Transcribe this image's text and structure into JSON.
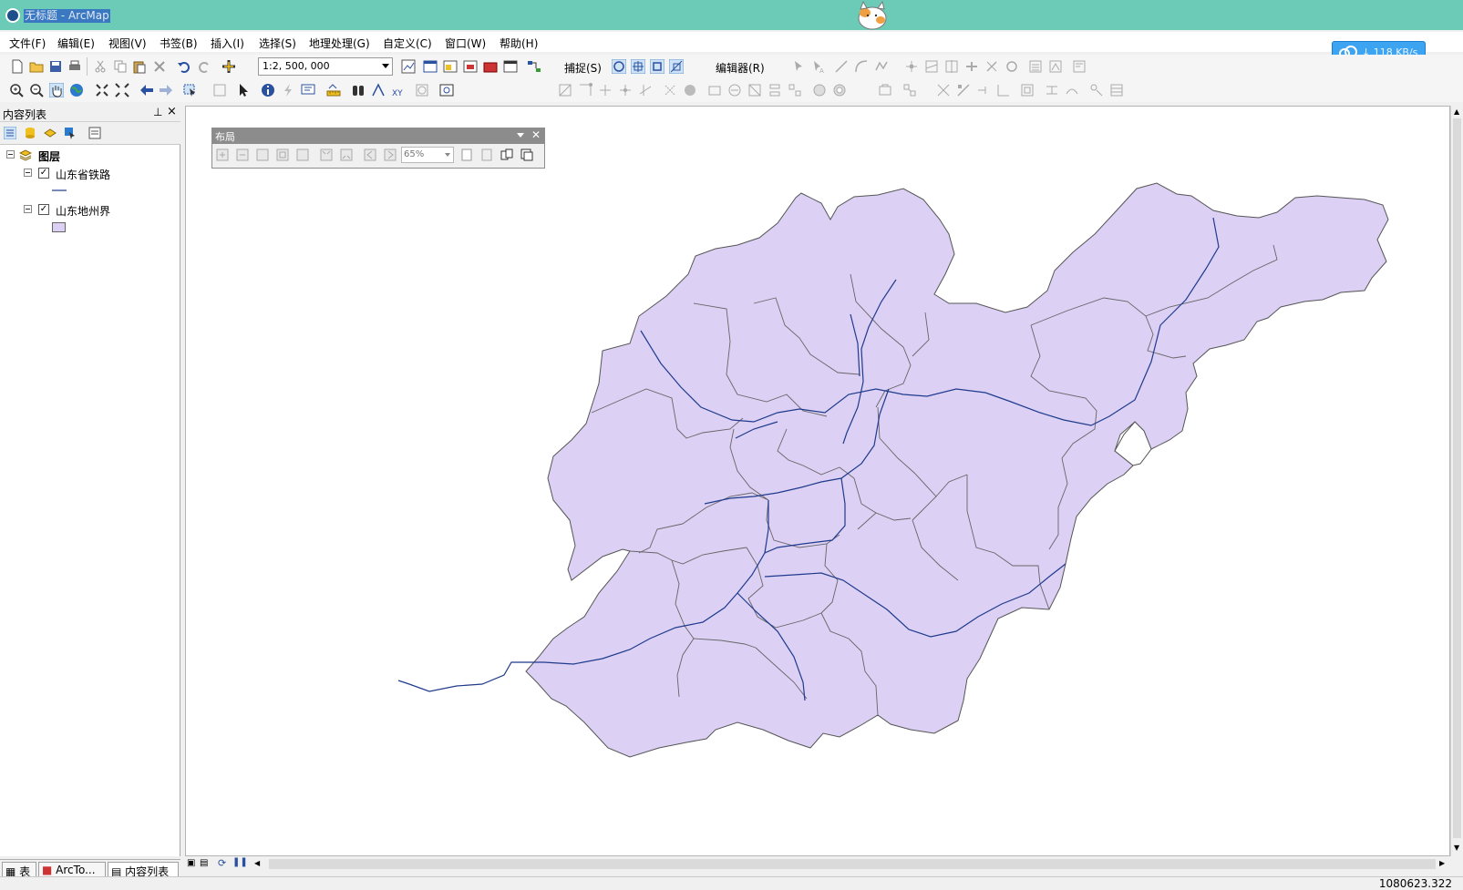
{
  "window": {
    "title": "无标题 - ArcMap"
  },
  "menu": [
    "文件(F)",
    "编辑(E)",
    "视图(V)",
    "书签(B)",
    "插入(I)",
    "选择(S)",
    "地理处理(G)",
    "自定义(C)",
    "窗口(W)",
    "帮助(H)"
  ],
  "speed": "↓ 118 KB/s",
  "toolbar": {
    "scale_value": "1:2, 500, 000",
    "snapping_label": "捕捉(S)",
    "editor_label": "编辑器(R)"
  },
  "toc": {
    "title": "内容列表",
    "root_label": "图层",
    "layers": [
      {
        "name": "山东省铁路",
        "checked": true
      },
      {
        "name": "山东地州界",
        "checked": true
      }
    ]
  },
  "layout_toolbar": {
    "title": "布局",
    "zoom": "65%"
  },
  "bottom_tabs": [
    "表",
    "ArcTo...",
    "内容列表"
  ],
  "status": {
    "coordinates": "1080623.322"
  },
  "colors": {
    "titlebar": "#6ccbb6",
    "polygon_fill": "#dcd0f5",
    "rail_line": "#1f3b8c"
  }
}
